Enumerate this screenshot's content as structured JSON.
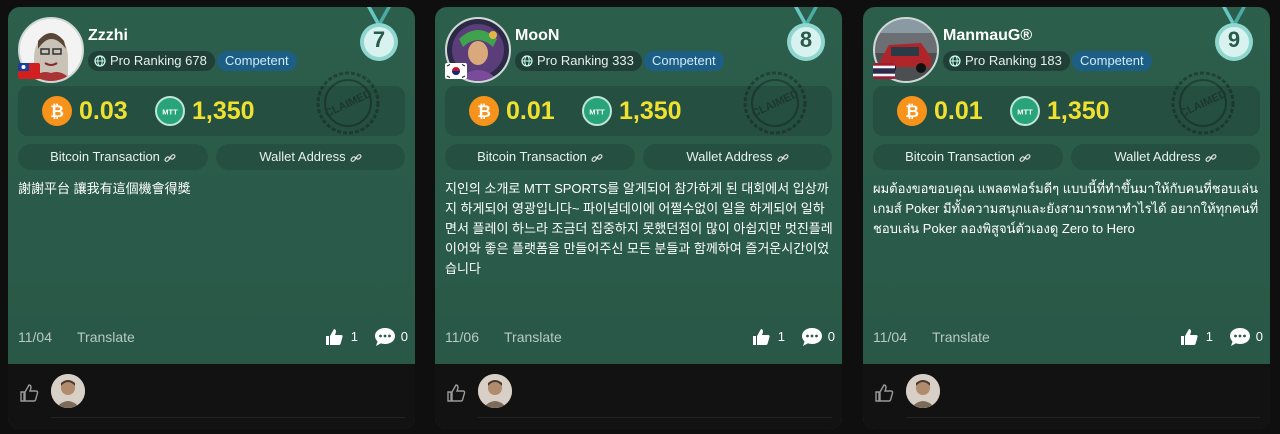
{
  "cards": [
    {
      "username": "Zzzhi",
      "rank_label": "Pro Ranking 678",
      "level_label": "Competent",
      "medal_number": "7",
      "btc_amount": "0.03",
      "mtt_amount": "1,350",
      "bitcoin_tx_label": "Bitcoin Transaction",
      "wallet_address_label": "Wallet Address",
      "text": "謝謝平台 讓我有這個機會得獎",
      "date": "11/04",
      "translate_label": "Translate",
      "likes": "1",
      "comments": "0",
      "flag": "taiwan-flag"
    },
    {
      "username": "MooN",
      "rank_label": "Pro Ranking 333",
      "level_label": "Competent",
      "medal_number": "8",
      "btc_amount": "0.01",
      "mtt_amount": "1,350",
      "bitcoin_tx_label": "Bitcoin Transaction",
      "wallet_address_label": "Wallet Address",
      "text": "지인의 소개로 MTT SPORTS를 알게되어 참가하게 된 대회에서 입상까지 하게되어 영광입니다~ 파이널데이에 어쩔수없이 일을 하게되어 일하면서 플레이 하느라 조금더 집중하지 못했던점이 많이 아쉽지만 멋진플레이어와 좋은 플랫폼을 만들어주신 모든 분들과 함께하여 즐거운시간이었습니다",
      "date": "11/06",
      "translate_label": "Translate",
      "likes": "1",
      "comments": "0",
      "flag": "korea-flag"
    },
    {
      "username": "ManmauG®",
      "rank_label": "Pro Ranking 183",
      "level_label": "Competent",
      "medal_number": "9",
      "btc_amount": "0.01",
      "mtt_amount": "1,350",
      "bitcoin_tx_label": "Bitcoin Transaction",
      "wallet_address_label": "Wallet Address",
      "text": "ผมต้องขอขอบคุณ แพลตฟอร์มดีๆ แบบนี้ที่ทำขึ้นมาให้กับคนที่ชอบเล่นเกมส์ Poker มีทั้งความสนุกและยังสามารถหาทำไรได้ อยากให้ทุกคนที่ชอบเล่น Poker ลองพิสูจน์ตัวเองดู Zero to Hero",
      "date": "11/04",
      "translate_label": "Translate",
      "likes": "1",
      "comments": "0",
      "flag": "thailand-flag"
    }
  ],
  "stamp_text": "CLAIMED",
  "colors": {
    "card_bg": "#2a5a49",
    "amount": "#f0e030",
    "level_badge": "#1d5f84",
    "btc": "#f7931a",
    "mtt": "#28a37a"
  }
}
